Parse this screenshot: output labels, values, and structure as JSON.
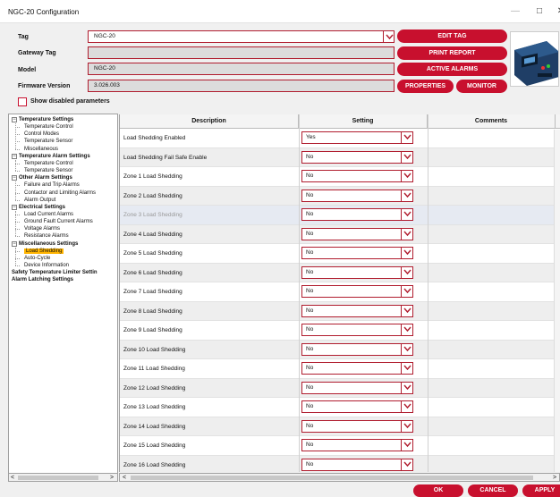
{
  "window": {
    "title": "NGC-20 Configuration"
  },
  "header": {
    "tag": {
      "label": "Tag",
      "value": "NGC-20"
    },
    "gateway_tag": {
      "label": "Gateway Tag",
      "value": ""
    },
    "model": {
      "label": "Model",
      "value": "NGC-20"
    },
    "firmware": {
      "label": "Firmware Version",
      "value": "3.026.003"
    },
    "show_disabled_label": "Show disabled parameters"
  },
  "buttons": {
    "edit_tag": "EDIT TAG",
    "print_report": "PRINT REPORT",
    "active_alarms": "ACTIVE ALARMS",
    "properties": "PROPERTIES",
    "monitor": "MONITOR",
    "ok": "OK",
    "cancel": "CANCEL",
    "apply": "APPLY"
  },
  "tree": [
    {
      "label": "Temperature Settings",
      "level": 0,
      "expanded": true
    },
    {
      "label": "Temperature Control",
      "level": 1
    },
    {
      "label": "Control Modes",
      "level": 1
    },
    {
      "label": "Temperature Sensor",
      "level": 1
    },
    {
      "label": "Miscellaneous",
      "level": 1
    },
    {
      "label": "Temperature Alarm Settings",
      "level": 0,
      "expanded": true
    },
    {
      "label": "Temperature Control",
      "level": 1
    },
    {
      "label": "Temperature Sensor",
      "level": 1
    },
    {
      "label": "Other Alarm Settings",
      "level": 0,
      "expanded": true
    },
    {
      "label": "Failure and Trip Alarms",
      "level": 1
    },
    {
      "label": "Contactor and Limiting Alarms",
      "level": 1
    },
    {
      "label": "Alarm Output",
      "level": 1
    },
    {
      "label": "Electrical Settings",
      "level": 0,
      "expanded": true
    },
    {
      "label": "Load Current Alarms",
      "level": 1
    },
    {
      "label": "Ground Fault Current Alarms",
      "level": 1
    },
    {
      "label": "Voltage Alarms",
      "level": 1
    },
    {
      "label": "Resistance Alarms",
      "level": 1
    },
    {
      "label": "Miscellaneous Settings",
      "level": 0,
      "expanded": true
    },
    {
      "label": "Load Shedding",
      "level": 1,
      "selected": true
    },
    {
      "label": "Auto-Cycle",
      "level": 1
    },
    {
      "label": "Device Information",
      "level": 1
    },
    {
      "label": "Safety Temperature Limiter Settin",
      "level": 0
    },
    {
      "label": "Alarm Latching Settings",
      "level": 0
    }
  ],
  "grid": {
    "columns": [
      "Description",
      "Setting",
      "Comments"
    ],
    "rows": [
      {
        "description": "Load Shedding Enabled",
        "setting": "Yes"
      },
      {
        "description": "Load Shedding Fail Safe Enable",
        "setting": "No"
      },
      {
        "description": "Zone 1 Load Shedding",
        "setting": "No"
      },
      {
        "description": "Zone 2 Load Shedding",
        "setting": "No"
      },
      {
        "description": "Zone 3 Load Shedding",
        "setting": "No",
        "disabled": true
      },
      {
        "description": "Zone 4 Load Shedding",
        "setting": "No"
      },
      {
        "description": "Zone 5 Load Shedding",
        "setting": "No"
      },
      {
        "description": "Zone 6 Load Shedding",
        "setting": "No"
      },
      {
        "description": "Zone 7 Load Shedding",
        "setting": "No"
      },
      {
        "description": "Zone 8 Load Shedding",
        "setting": "No"
      },
      {
        "description": "Zone 9 Load Shedding",
        "setting": "No"
      },
      {
        "description": "Zone 10 Load Shedding",
        "setting": "No"
      },
      {
        "description": "Zone 11 Load Shedding",
        "setting": "No"
      },
      {
        "description": "Zone 12 Load Shedding",
        "setting": "No"
      },
      {
        "description": "Zone 13 Load Shedding",
        "setting": "No"
      },
      {
        "description": "Zone 14 Load Shedding",
        "setting": "No"
      },
      {
        "description": "Zone 15 Load Shedding",
        "setting": "No"
      },
      {
        "description": "Zone 16 Load Shedding",
        "setting": "No"
      }
    ]
  },
  "colors": {
    "brand_red": "#c8102e",
    "selection": "#ffb400",
    "disabled_text": "#9a9a9a"
  },
  "icons": [
    "minimize-icon",
    "maximize-icon",
    "close-icon",
    "chevron-down-icon",
    "expand-collapse-icon",
    "device-image"
  ]
}
